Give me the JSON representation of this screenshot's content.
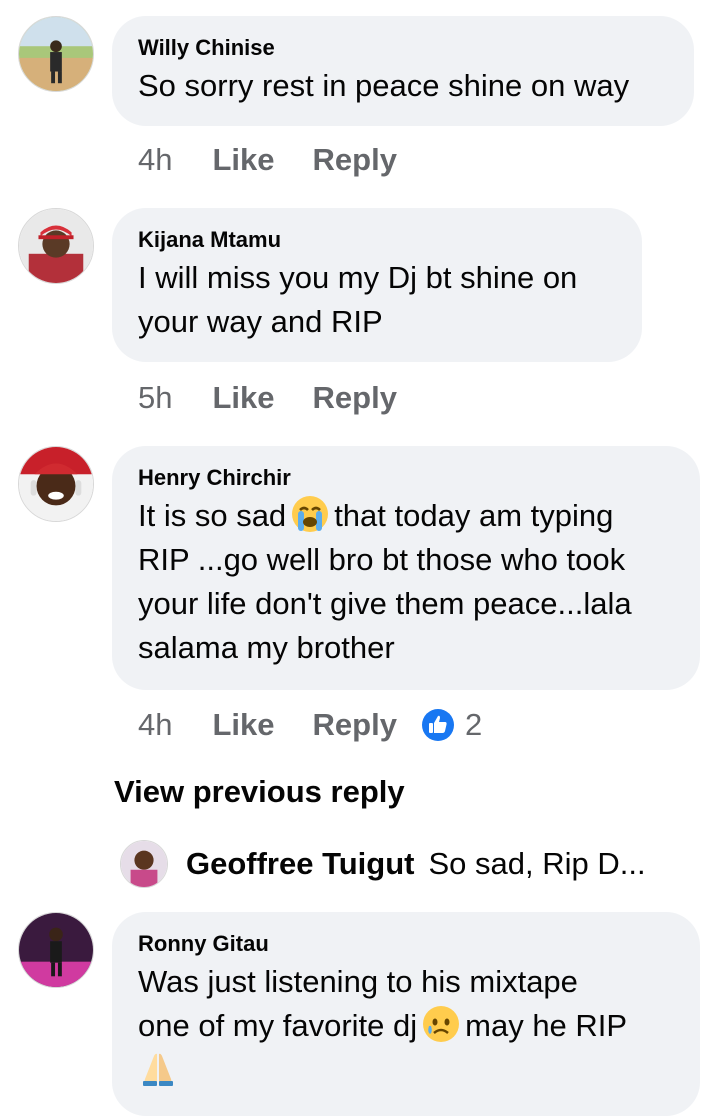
{
  "comments": [
    {
      "author": "Willy Chinise",
      "text": "So sorry rest in peace shine on way",
      "time": "4h",
      "like": "Like",
      "reply": "Reply"
    },
    {
      "author": "Kijana Mtamu",
      "text_line1": "I will miss you my Dj bt shine on",
      "text_line2": "your way and RIP",
      "time": "5h",
      "like": "Like",
      "reply": "Reply"
    },
    {
      "author": "Henry Chirchir",
      "text_line1_a": "It is so sad",
      "text_line1_b": "that today am typing",
      "text_line2": "RIP ...go well bro bt those who took",
      "text_line3": "your life don't give them peace...lala",
      "text_line4": "salama my brother",
      "emoji": "loudly-crying-face",
      "time": "4h",
      "like": "Like",
      "reply": "Reply",
      "reaction_icon": "like-reaction-icon",
      "reaction_count": "2",
      "view_previous": "View previous reply",
      "reply_preview": {
        "author": "Geoffree Tuigut",
        "text": "So sad, Rip D..."
      }
    },
    {
      "author": "Ronny Gitau",
      "text_line1": "Was just listening to his mixtape",
      "text_line2_a": "one of my favorite dj",
      "text_line2_b": "may he RIP",
      "emoji1": "sad-tear-face",
      "emoji2": "folded-hands"
    }
  ],
  "colors": {
    "bubble": "#f0f2f5",
    "meta": "#65676b",
    "like_blue": "#1877f2"
  }
}
